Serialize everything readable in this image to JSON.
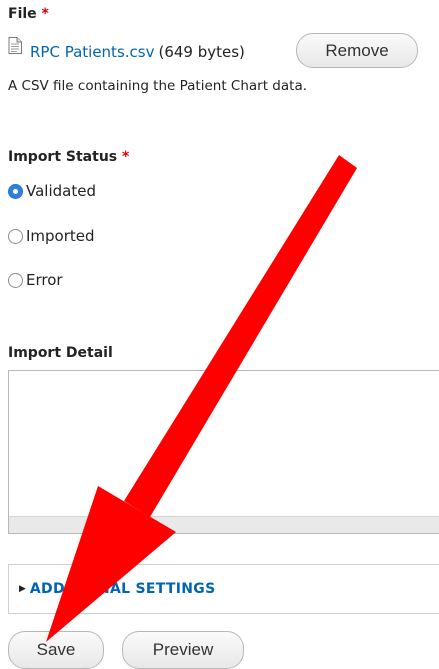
{
  "file_field": {
    "label": "File",
    "required_marker": "*",
    "file_name": "RPC Patients.csv",
    "file_size": "(649 bytes)",
    "remove_label": "Remove",
    "description": "A CSV file containing the Patient Chart data.",
    "file_icon": "document-icon"
  },
  "import_status": {
    "label": "Import Status",
    "required_marker": "*",
    "options": [
      {
        "label": "Validated",
        "checked": true
      },
      {
        "label": "Imported",
        "checked": false
      },
      {
        "label": "Error",
        "checked": false
      }
    ],
    "selected_color": "#2f7fe0"
  },
  "import_detail": {
    "label": "Import Detail",
    "value": ""
  },
  "additional_settings": {
    "summary": "ADDITIONAL SETTINGS",
    "expanded": false,
    "link_color": "#0064b4"
  },
  "actions": {
    "save_label": "Save",
    "preview_label": "Preview"
  },
  "annotation": {
    "icon": "red-arrow-icon",
    "color": "#ff0000"
  }
}
